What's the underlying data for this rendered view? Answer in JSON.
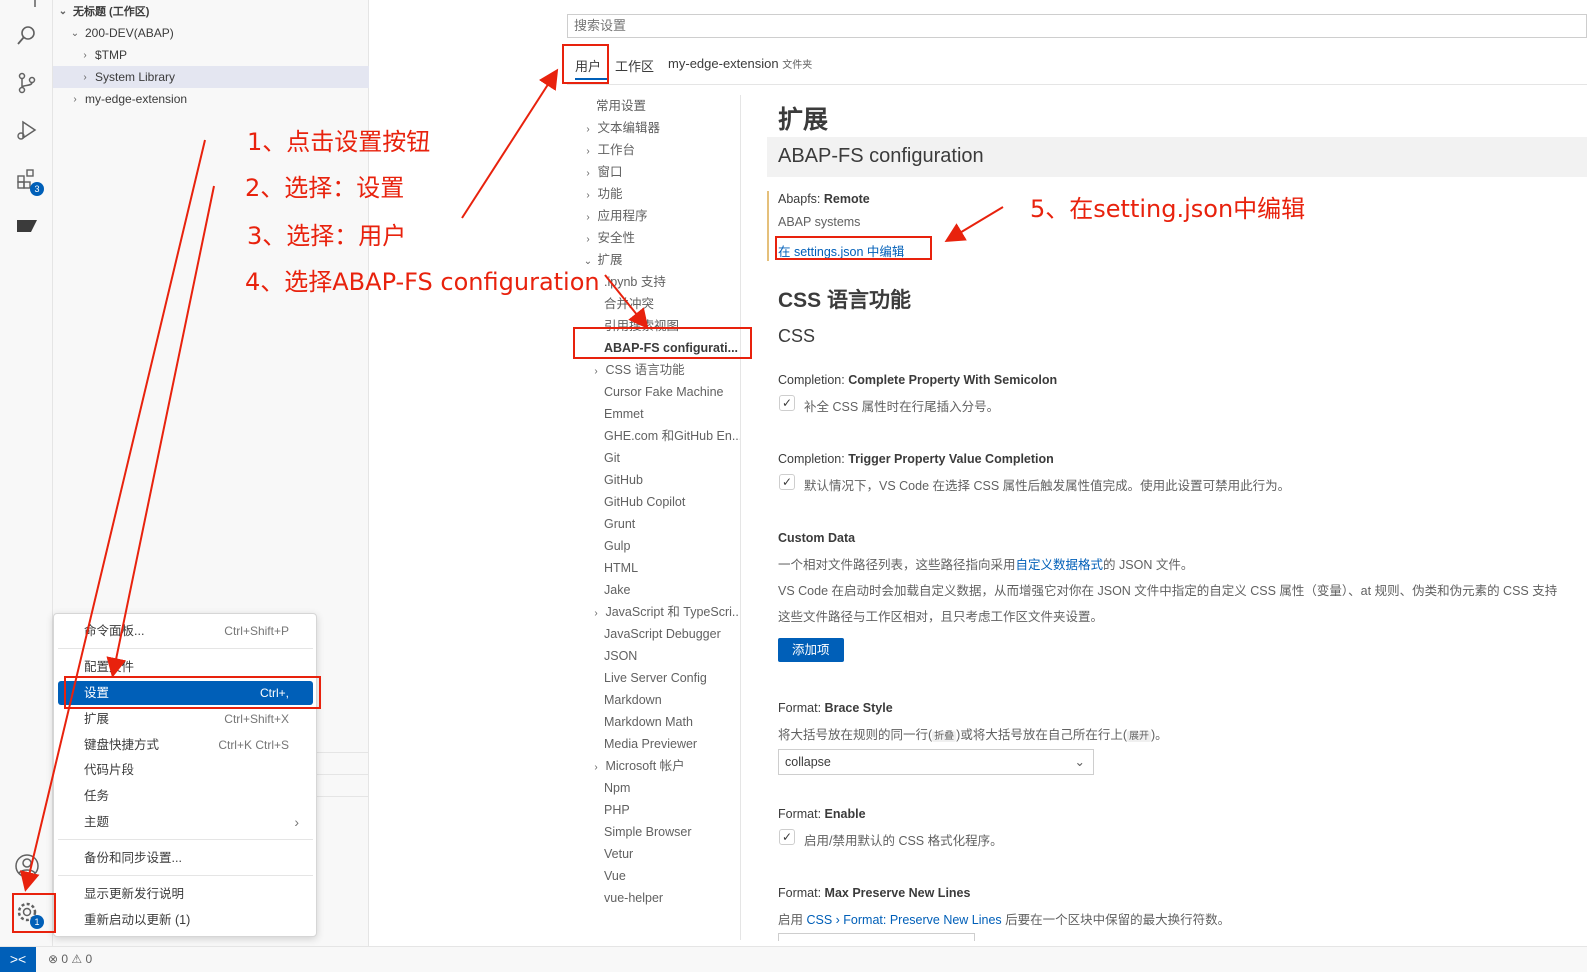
{
  "explorer": {
    "workspace_title": "无标题 (工作区)",
    "items": [
      {
        "label": "200-DEV(ABAP)"
      },
      {
        "label": "$TMP"
      },
      {
        "label": "System Library"
      },
      {
        "label": "my-edge-extension"
      }
    ]
  },
  "activity": {
    "extensions_badge": "3",
    "gear_badge": "1"
  },
  "settings": {
    "search_placeholder": "搜索设置",
    "tabs": {
      "user": "用户",
      "workspace": "工作区",
      "folder": "my-edge-extension",
      "folder_suffix": "文件夹"
    },
    "toc": [
      "常用设置",
      "文本编辑器",
      "工作台",
      "窗口",
      "功能",
      "应用程序",
      "安全性",
      "扩展",
      ".ipynb 支持",
      "合并冲突",
      "引用搜索视图",
      "ABAP-FS configurati...",
      "CSS 语言功能",
      "Cursor Fake Machine",
      "Emmet",
      "GHE.com 和GitHub En...",
      "Git",
      "GitHub",
      "GitHub Copilot",
      "Grunt",
      "Gulp",
      "HTML",
      "Jake",
      "JavaScript 和 TypeScri...",
      "JavaScript Debugger",
      "JSON",
      "Live Server Config",
      "Markdown",
      "Markdown Math",
      "Media Previewer",
      "Microsoft 帐户",
      "Npm",
      "PHP",
      "Simple Browser",
      "Vetur",
      "Vue",
      "vue-helper"
    ],
    "content": {
      "section_title": "扩展",
      "abapfs_title": "ABAP-FS configuration",
      "remote_prefix": "Abapfs: ",
      "remote_label": "Remote",
      "remote_desc": "ABAP systems",
      "edit_json_link": "在 settings.json 中编辑",
      "css_title": "CSS 语言功能",
      "css_sub": "CSS",
      "semicolon_prefix": "Completion: ",
      "semicolon_label": "Complete Property With Semicolon",
      "semicolon_desc": "补全 CSS 属性时在行尾插入分号。",
      "trigger_prefix": "Completion: ",
      "trigger_label": "Trigger Property Value Completion",
      "trigger_desc": "默认情况下，VS Code 在选择 CSS 属性后触发属性值完成。使用此设置可禁用此行为。",
      "custom_label": "Custom Data",
      "custom_desc1_a": "一个相对文件路径列表，这些路径指向采用",
      "custom_desc1_link": "自定义数据格式",
      "custom_desc1_b": "的 JSON 文件。",
      "custom_desc2": "VS Code 在启动时会加载自定义数据，从而增强它对你在 JSON 文件中指定的自定义 CSS 属性（变量）、at 规则、伪类和伪元素的 CSS 支持",
      "custom_desc3": "这些文件路径与工作区相对，且只考虑工作区文件夹设置。",
      "add_item_button": "添加项",
      "brace_prefix": "Format: ",
      "brace_label": "Brace Style",
      "brace_desc_a": "将大括号放在规则的同一行(",
      "brace_kbd1": "折叠",
      "brace_desc_b": ")或将大括号放在自己所在行上(",
      "brace_kbd2": "展开",
      "brace_desc_c": ")。",
      "brace_value": "collapse",
      "enable_prefix": "Format: ",
      "enable_label": "Enable",
      "enable_desc": "启用/禁用默认的 CSS 格式化程序。",
      "maxlines_prefix": "Format: ",
      "maxlines_label": "Max Preserve New Lines",
      "maxlines_desc_a": "启用 ",
      "maxlines_desc_link": "CSS › Format: Preserve New Lines",
      "maxlines_desc_b": " 后要在一个区块中保留的最大换行符数。"
    }
  },
  "menu": {
    "items": [
      {
        "label": "命令面板...",
        "shortcut": "Ctrl+Shift+P"
      },
      {
        "label": "配置文件",
        "shortcut": ""
      },
      {
        "label": "设置",
        "shortcut": "Ctrl+,"
      },
      {
        "label": "扩展",
        "shortcut": "Ctrl+Shift+X"
      },
      {
        "label": "键盘快捷方式",
        "shortcut": "Ctrl+K Ctrl+S"
      },
      {
        "label": "代码片段",
        "shortcut": ""
      },
      {
        "label": "任务",
        "shortcut": ""
      },
      {
        "label": "主题",
        "shortcut": "›"
      },
      {
        "label": "备份和同步设置...",
        "shortcut": ""
      },
      {
        "label": "显示更新发行说明",
        "shortcut": ""
      },
      {
        "label": "重新启动以更新 (1)",
        "shortcut": ""
      }
    ]
  },
  "status": {
    "remote_icon": "><",
    "problems": "⊗ 0 ⚠ 0"
  },
  "annotations": {
    "step1": "1、点击设置按钮",
    "step2": "2、选择：设置",
    "step3": "3、选择：用户",
    "step4": "4、选择ABAP-FS configuration",
    "step5": "5、在setting.json中编辑"
  },
  "colors": {
    "accent": "#005fb8",
    "annotation": "#e8220d"
  }
}
